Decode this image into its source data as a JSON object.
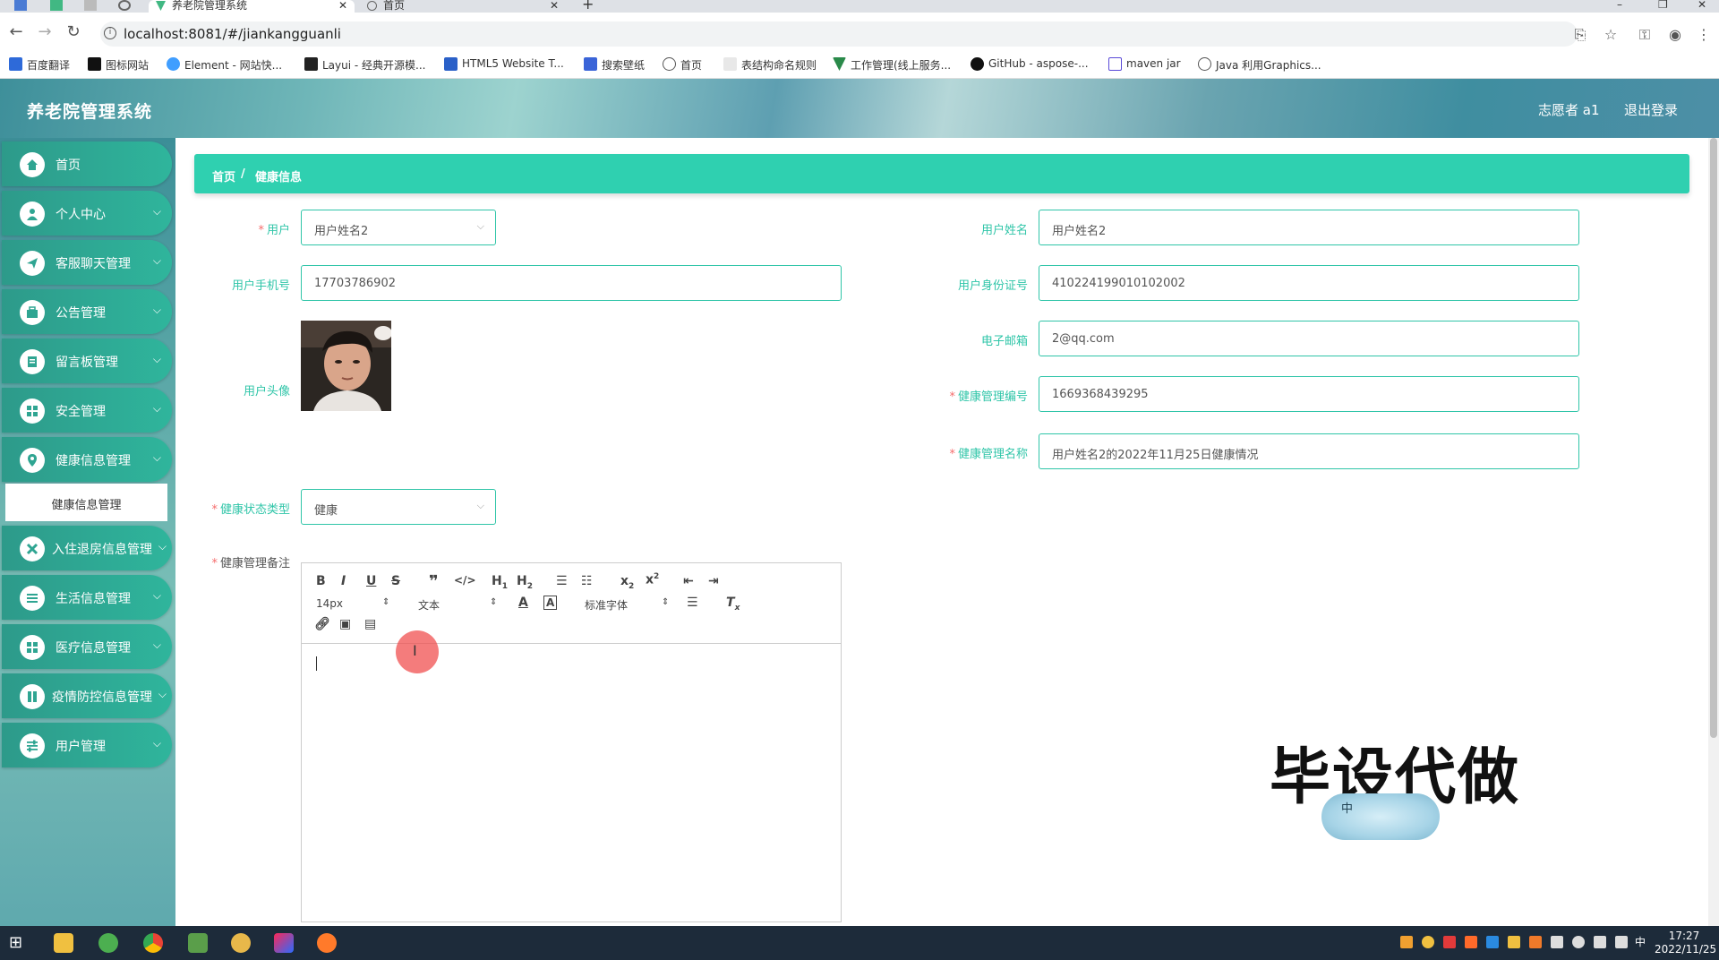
{
  "browser": {
    "tabs": [
      {
        "title": "养老院管理系统",
        "active": true
      },
      {
        "title": "首页",
        "active": false
      }
    ],
    "url": "localhost:8081/#/jiankangguanli",
    "bookmarks": [
      "百度翻译",
      "图标网站",
      "Element - 网站快...",
      "Layui - 经典开源模...",
      "HTML5 Website T...",
      "搜索壁纸",
      "首页",
      "表结构命名规则",
      "工作管理(线上服务...",
      "GitHub - aspose-...",
      "maven jar",
      "Java 利用Graphics..."
    ]
  },
  "header": {
    "title": "养老院管理系统",
    "user": "志愿者 a1",
    "logout": "退出登录"
  },
  "sidebar": {
    "items": [
      {
        "label": "首页",
        "icon": "home-icon",
        "has_children": false
      },
      {
        "label": "个人中心",
        "icon": "user-icon",
        "has_children": true
      },
      {
        "label": "客服聊天管理",
        "icon": "send-icon",
        "has_children": true
      },
      {
        "label": "公告管理",
        "icon": "briefcase-icon",
        "has_children": true
      },
      {
        "label": "留言板管理",
        "icon": "document-icon",
        "has_children": true
      },
      {
        "label": "安全管理",
        "icon": "grid-icon",
        "has_children": true
      },
      {
        "label": "健康信息管理",
        "icon": "location-icon",
        "has_children": true
      },
      {
        "label": "入住退房信息管理",
        "icon": "cross-icon",
        "has_children": true
      },
      {
        "label": "生活信息管理",
        "icon": "list-icon",
        "has_children": true
      },
      {
        "label": "医疗信息管理",
        "icon": "grid-icon",
        "has_children": true
      },
      {
        "label": "疫情防控信息管理",
        "icon": "book-icon",
        "has_children": true
      },
      {
        "label": "用户管理",
        "icon": "sliders-icon",
        "has_children": true
      }
    ],
    "active_submenu": "健康信息管理"
  },
  "breadcrumb": {
    "home": "首页",
    "separator": "/",
    "current": "健康信息"
  },
  "form": {
    "user_label": "用户",
    "user_value": "用户姓名2",
    "username_label": "用户姓名",
    "username_value": "用户姓名2",
    "phone_label": "用户手机号",
    "phone_value": "17703786902",
    "idcard_label": "用户身份证号",
    "idcard_value": "410224199010102002",
    "avatar_label": "用户头像",
    "email_label": "电子邮箱",
    "email_value": "2@qq.com",
    "health_no_label": "健康管理编号",
    "health_no_value": "1669368439295",
    "health_name_label": "健康管理名称",
    "health_name_value": "用户姓名2的2022年11月25日健康情况",
    "status_type_label": "健康状态类型",
    "status_type_value": "健康",
    "remark_label": "健康管理备注",
    "required_mark": "*"
  },
  "editor": {
    "font_size": "14px",
    "header_select": "文本",
    "font_family": "标准字体"
  },
  "watermark": "毕设代做",
  "ime_indicator": "中",
  "taskbar": {
    "time": "17:27",
    "date": "2022/11/25",
    "ime": "中"
  }
}
